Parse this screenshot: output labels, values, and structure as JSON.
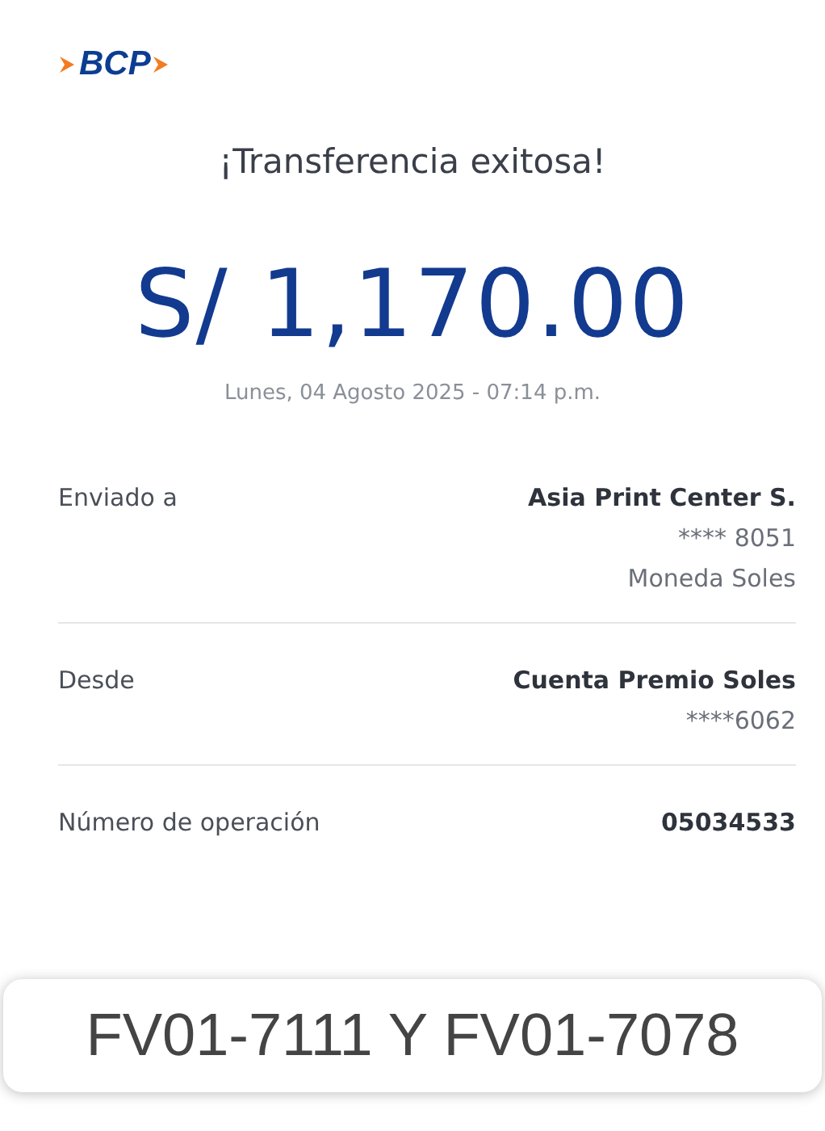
{
  "logo": {
    "text": "BCP"
  },
  "title": "¡Transferencia exitosa!",
  "amount": "S/ 1,170.00",
  "datetime": "Lunes, 04 Agosto 2025 - 07:14 p.m.",
  "details": [
    {
      "label": "Enviado a",
      "values": [
        "Asia Print Center S.",
        "**** 8051",
        "Moneda Soles"
      ]
    },
    {
      "label": "Desde",
      "values": [
        "Cuenta Premio Soles",
        "****6062"
      ]
    },
    {
      "label": "Número de operación",
      "values": [
        "05034533"
      ]
    }
  ],
  "note": "FV01-7111 Y FV01-7078"
}
